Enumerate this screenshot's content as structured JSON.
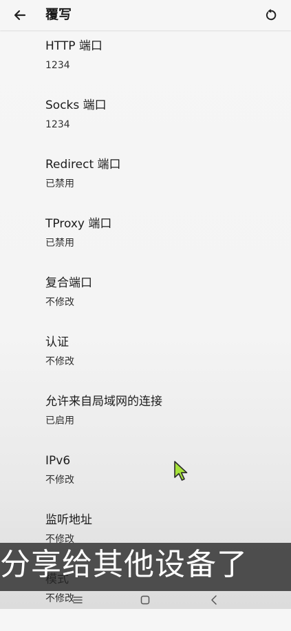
{
  "header": {
    "title": "覆写",
    "back_icon": "arrow-left-icon",
    "reset_icon": "reset-icon"
  },
  "settings": [
    {
      "label": "HTTP 端口",
      "value": "1234"
    },
    {
      "label": "Socks 端口",
      "value": "1234"
    },
    {
      "label": "Redirect 端口",
      "value": "已禁用"
    },
    {
      "label": "TProxy 端口",
      "value": "已禁用"
    },
    {
      "label": "复合端口",
      "value": "不修改"
    },
    {
      "label": "认证",
      "value": "不修改"
    },
    {
      "label": "允许来自局域网的连接",
      "value": "已启用"
    },
    {
      "label": "IPv6",
      "value": "不修改"
    },
    {
      "label": "监听地址",
      "value": "不修改"
    },
    {
      "label": "模式",
      "value": "不修改"
    }
  ],
  "overlay": {
    "subtitle": "分享给其他设备了"
  },
  "navbar": {
    "icons": [
      "menu-icon",
      "home-icon",
      "back-chevron-icon"
    ]
  },
  "colors": {
    "cursor": "#a6e23a",
    "subtitle_background": "#2a2a2a"
  }
}
